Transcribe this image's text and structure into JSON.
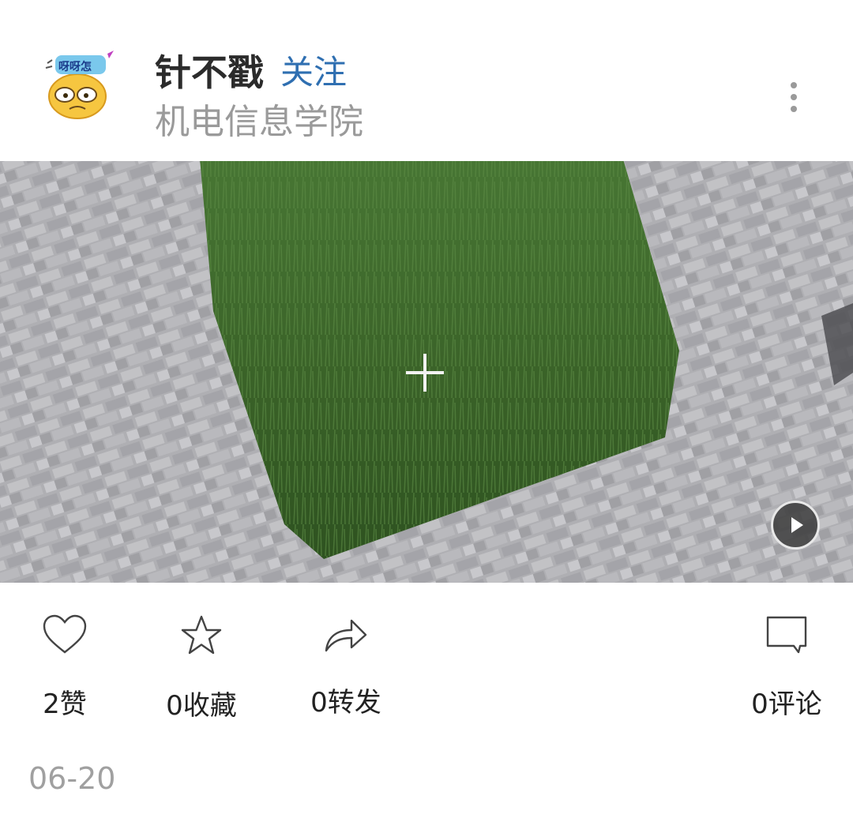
{
  "post": {
    "author_name": "针不戳",
    "follow_label": "关注",
    "school": "机电信息学院",
    "avatar_label": "呀呀怎",
    "date": "06-20"
  },
  "actions": {
    "like_count": "2赞",
    "favorite_count": "0收藏",
    "share_count": "0转发",
    "comment_count": "0评论"
  },
  "colors": {
    "follow_blue": "#2f6fb1",
    "muted_gray": "#9a9a9a",
    "grass_green": "#3e6a2c"
  },
  "icons": [
    "more-vertical-icon",
    "play-icon",
    "heart-icon",
    "star-icon",
    "share-arrow-icon",
    "comment-icon",
    "crosshair-icon"
  ]
}
